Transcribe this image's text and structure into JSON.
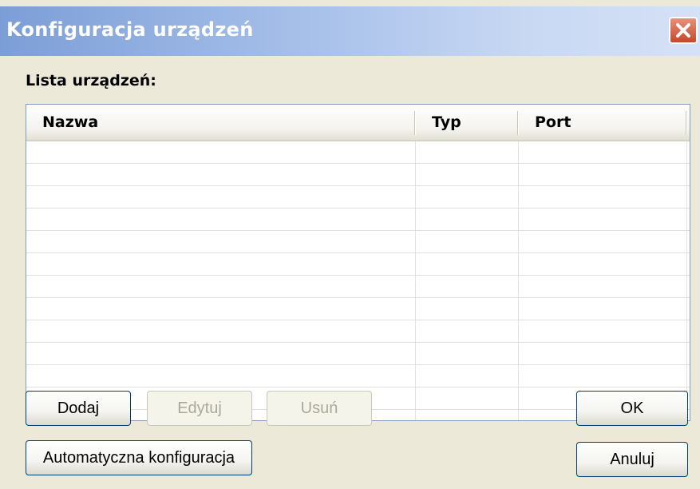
{
  "window": {
    "title": "Konfiguracja urządzeń",
    "close_icon": "close-icon"
  },
  "device_list": {
    "label": "Lista urządzeń:",
    "columns": [
      "Nazwa",
      "Typ",
      "Port"
    ],
    "rows": []
  },
  "buttons": {
    "add": "Dodaj",
    "edit": "Edytuj",
    "remove": "Usuń",
    "auto_config": "Automatyczna konfiguracja",
    "ok": "OK",
    "cancel": "Anuluj"
  },
  "colors": {
    "titlebar_start": "#7c9ed7",
    "close_button": "#c5482a",
    "dialog_background": "#ece9d8"
  }
}
